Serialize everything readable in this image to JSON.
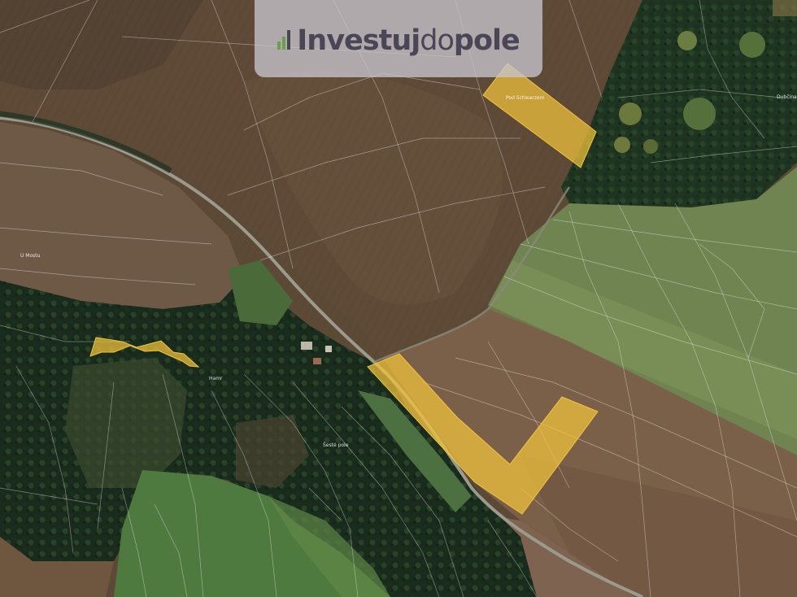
{
  "brand": {
    "part1": "Investuj",
    "part2": "do",
    "part3": "pole",
    "icon": "bar-chart-icon"
  },
  "map": {
    "highlight_color": "#f2c43c",
    "labels": {
      "pod_schwarzem": "Pod Schwarzem",
      "u_mostu": "U Mostu",
      "dubcina": "Dubčina",
      "gray_area": "Šesté pole",
      "hamr": "Hamr"
    }
  }
}
